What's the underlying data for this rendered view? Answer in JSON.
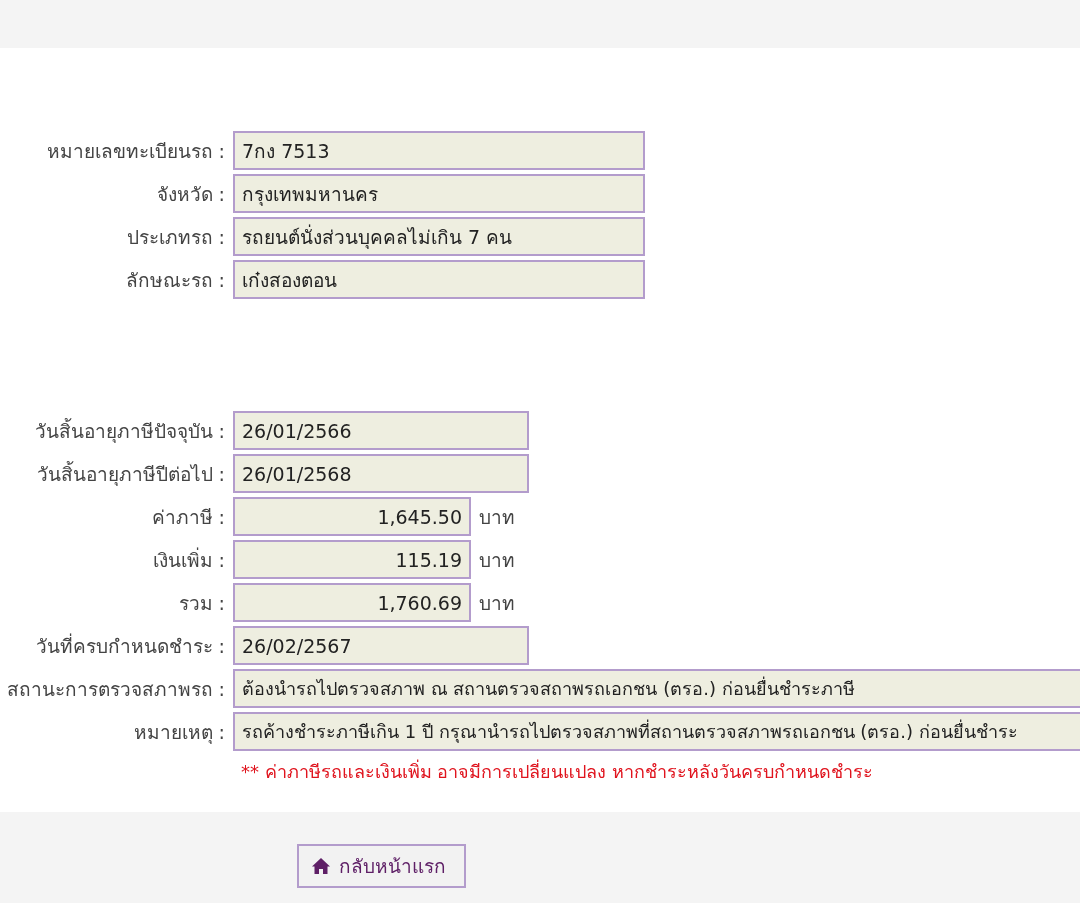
{
  "vehicle": [
    {
      "label": "หมายเลขทะเบียนรถ :",
      "value": "7กง 7513",
      "kind": "wide"
    },
    {
      "label": "จังหวัด :",
      "value": "กรุงเทพมหานคร",
      "kind": "wide"
    },
    {
      "label": "ประเภทรถ :",
      "value": "รถยนต์นั่งส่วนบุคคลไม่เกิน 7 คน",
      "kind": "wide"
    },
    {
      "label": "ลักษณะรถ :",
      "value": "เก๋งสองตอน",
      "kind": "wide"
    }
  ],
  "tax": [
    {
      "label": "วันสิ้นอายุภาษีปัจจุบัน :",
      "value": "26/01/2566",
      "kind": "date"
    },
    {
      "label": "วันสิ้นอายุภาษีปีต่อไป :",
      "value": "26/01/2568",
      "kind": "date"
    },
    {
      "label": "ค่าภาษี :",
      "value": "1,645.50",
      "kind": "amount",
      "unit": "บาท"
    },
    {
      "label": "เงินเพิ่ม :",
      "value": "115.19",
      "kind": "amount",
      "unit": "บาท"
    },
    {
      "label": "รวม :",
      "value": "1,760.69",
      "kind": "amount",
      "unit": "บาท"
    },
    {
      "label": "วันที่ครบกำหนดชำระ :",
      "value": "26/02/2567",
      "kind": "date"
    },
    {
      "label": "สถานะการตรวจสภาพรถ :",
      "value": "ต้องนำรถไปตรวจสภาพ ณ สถานตรวจสถาพรถเอกชน (ตรอ.) ก่อนยื่นชำระภาษี",
      "kind": "full"
    },
    {
      "label": "หมายเหตุ :",
      "value": "รถค้างชำระภาษีเกิน 1 ปี กรุณานำรถไปตรวจสภาพที่สถานตรวจสภาพรถเอกชน (ตรอ.) ก่อนยื่นชำระ",
      "kind": "full"
    }
  ],
  "warning": "** ค่าภาษีรถและเงินเพิ่ม อาจมีการเปลี่ยนแปลง หากชำระหลังวันครบกำหนดชำระ",
  "home_button": "กลับหน้าแรก"
}
